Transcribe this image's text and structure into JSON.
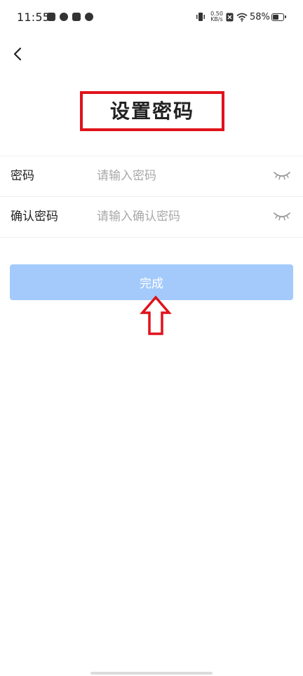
{
  "status_bar": {
    "time": "11:55",
    "net_speed_value": "0.50",
    "net_speed_unit": "KB/s",
    "battery_percent_label": "58%",
    "battery_level": 0.58,
    "icons": [
      "notification-icon",
      "sync-icon",
      "message-icon",
      "app-icon",
      "vibrate-icon",
      "sim-off-icon",
      "wifi-icon",
      "battery-icon"
    ]
  },
  "header": {
    "back_icon": "chevron-left-icon",
    "title": "设置密码",
    "title_highlight_color": "#e0121b"
  },
  "form": {
    "fields": [
      {
        "label": "密码",
        "placeholder": "请输入密码",
        "value": "",
        "toggle_icon": "eye-closed-icon"
      },
      {
        "label": "确认密码",
        "placeholder": "请输入确认密码",
        "value": "",
        "toggle_icon": "eye-closed-icon"
      }
    ]
  },
  "submit": {
    "label": "完成",
    "color": "#a3cafb"
  },
  "annotation": {
    "icon": "up-arrow-annotation",
    "color": "#e0121b"
  }
}
